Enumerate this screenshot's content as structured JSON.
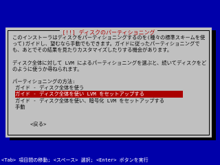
{
  "dialog": {
    "title": "[!!] ディスクのパーティショニング",
    "description": "このインストーラはディスクをパーティショニングするのを(種々の標準スキームを使って)ガイドし、望むなら手動でもできます。ガイドに従ったパーティショニングでも、あとでその結果を見たりカスタマイズしたりする機会があります。",
    "instruction": "ディスク全体に対して LVM によるパーティショニングを選ぶと、続いてディスクをどのように使うか尋ねられます。",
    "method_label": "パーティショニングの方法:",
    "options": [
      "ガイド - ディスク全体を使う",
      "ガイド - ディスク全体を使い LVM をセットアップする",
      "ガイド - ディスク全体を使い、暗号化 LVM をセットアップする",
      "手動"
    ],
    "selected_index": 1,
    "back_button": "<戻る>"
  },
  "statusbar": {
    "text": "<Tab> 項目間の移動; <スペース> 選択; <Enter> ボタンを実行"
  },
  "colors": {
    "background": "#0000aa",
    "dialog": "#c0c0c0",
    "title": "#aa0000",
    "selection": "#aa0000"
  }
}
